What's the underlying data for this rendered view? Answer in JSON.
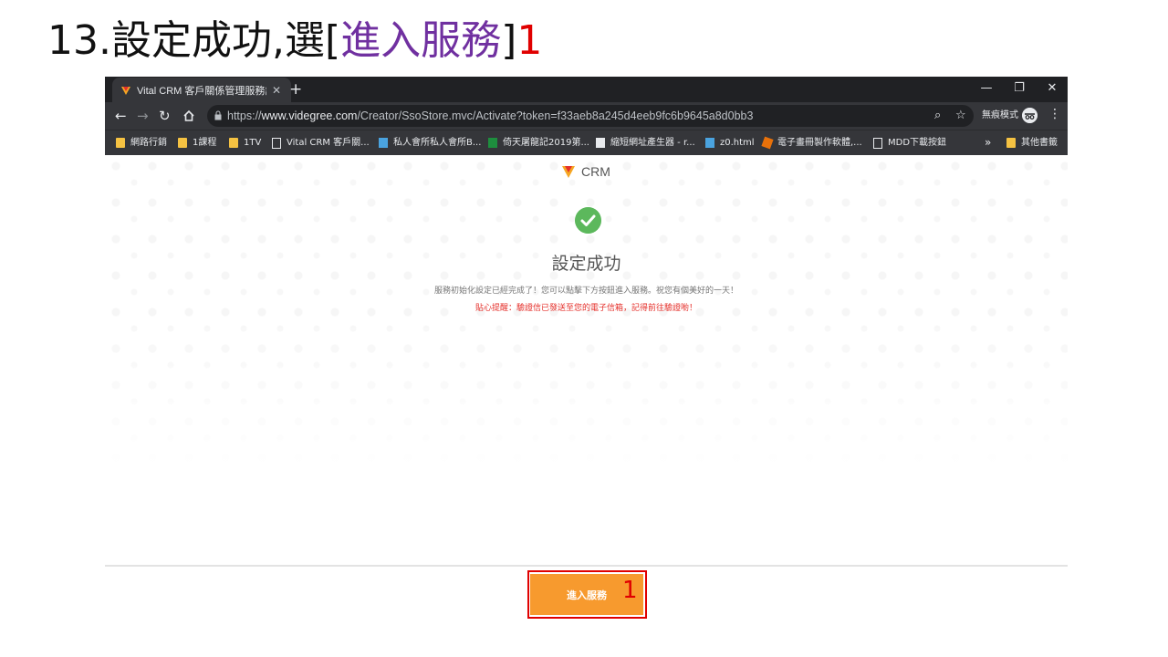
{
  "slide": {
    "title_prefix": "13.設定成功,選[",
    "title_highlight": "進入服務",
    "title_suffix": "]",
    "title_number": "1",
    "colors": {
      "highlight": "#7030a0",
      "annotation": "#e00000"
    }
  },
  "browser": {
    "tab": {
      "title": "Vital CRM 客戶關係管理服務設...",
      "close_icon": "close-icon"
    },
    "new_tab_label": "+",
    "window_controls": [
      "—",
      "❐",
      "✕"
    ],
    "url": {
      "scheme": "https://",
      "host": "www.videgree.com",
      "path": "/Creator/SsoStore.mvc/Activate?token=f33aeb8a245d4eeb9fc6b9645a8d0bb3"
    },
    "incognito_label": "無痕模式",
    "bookmarks": [
      {
        "label": "網路行銷",
        "icon": "folder"
      },
      {
        "label": "1課程",
        "icon": "folder"
      },
      {
        "label": "1TV",
        "icon": "folder"
      },
      {
        "label": "Vital CRM 客戶關...",
        "icon": "page"
      },
      {
        "label": "私人會所私人會所B...",
        "icon": "blue"
      },
      {
        "label": "倚天屠龍記2019第...",
        "icon": "green"
      },
      {
        "label": "縮短網址產生器 - r...",
        "icon": "mono"
      },
      {
        "label": "z0.html",
        "icon": "blue"
      },
      {
        "label": "電子畫冊製作軟體,...",
        "icon": "orange"
      },
      {
        "label": "MDD下載按鈕",
        "icon": "page"
      }
    ],
    "bookmarks_more": "»",
    "other_bookmarks": "其他書籤"
  },
  "page": {
    "logo_text": "CRM",
    "success_title": "設定成功",
    "message": "服務初始化設定已經完成了！您可以點擊下方按鈕進入服務。祝您有個美好的一天！",
    "reminder": "貼心提醒：驗證信已發送至您的電子信箱，記得前往驗證喲！",
    "enter_button": "進入服務",
    "annotation_number": "1",
    "colors": {
      "button": "#f79a2e",
      "success": "#5cb85c",
      "reminder": "#e5302b"
    }
  }
}
